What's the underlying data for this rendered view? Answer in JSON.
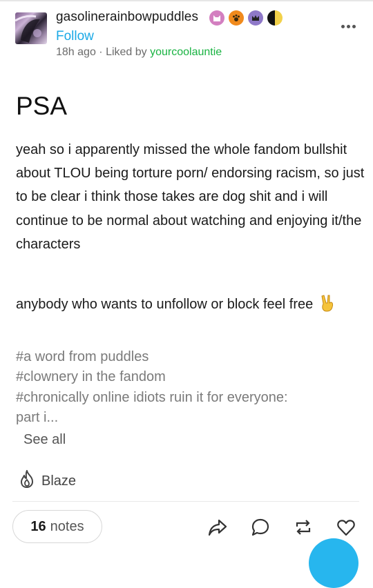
{
  "post": {
    "username": "gasolinerainbowpuddles",
    "follow_label": "Follow",
    "time": "18h ago",
    "separator": "·",
    "liked_prefix": "Liked by",
    "liked_by": "yourcoolauntie",
    "title": "PSA",
    "body_paragraph_1": "yeah so i apparently missed the whole fandom bullshit about TLOU being torture porn/ endorsing racism, so just to be clear i think those takes are dog shit and i will continue to be normal about watching and enjoying it/the characters",
    "body_paragraph_2": "anybody who wants to unfollow or block feel free",
    "body_emoji": "victory-hand-emoji",
    "tags": [
      "#a word from puddles",
      "#clownery in the fandom",
      "#chronically online idiots ruin it for everyone:",
      "part i..."
    ],
    "see_all_label": "See all",
    "blaze_label": "Blaze",
    "notes_count": "16",
    "notes_label": "notes"
  },
  "icons": {
    "more": "more-horizontal-icon",
    "blaze": "flame-icon",
    "share": "share-arrow-icon",
    "reply": "speech-bubble-icon",
    "reblog": "reblog-icon",
    "like": "heart-icon",
    "badges": [
      "pink-cat-badge-icon",
      "orange-paw-badge-icon",
      "purple-crown-badge-icon",
      "half-moon-badge-icon"
    ]
  },
  "colors": {
    "follow": "#1aa9e6",
    "liked_by": "#19b342",
    "tags": "#7a7a7a",
    "fab": "#27b6ee"
  }
}
